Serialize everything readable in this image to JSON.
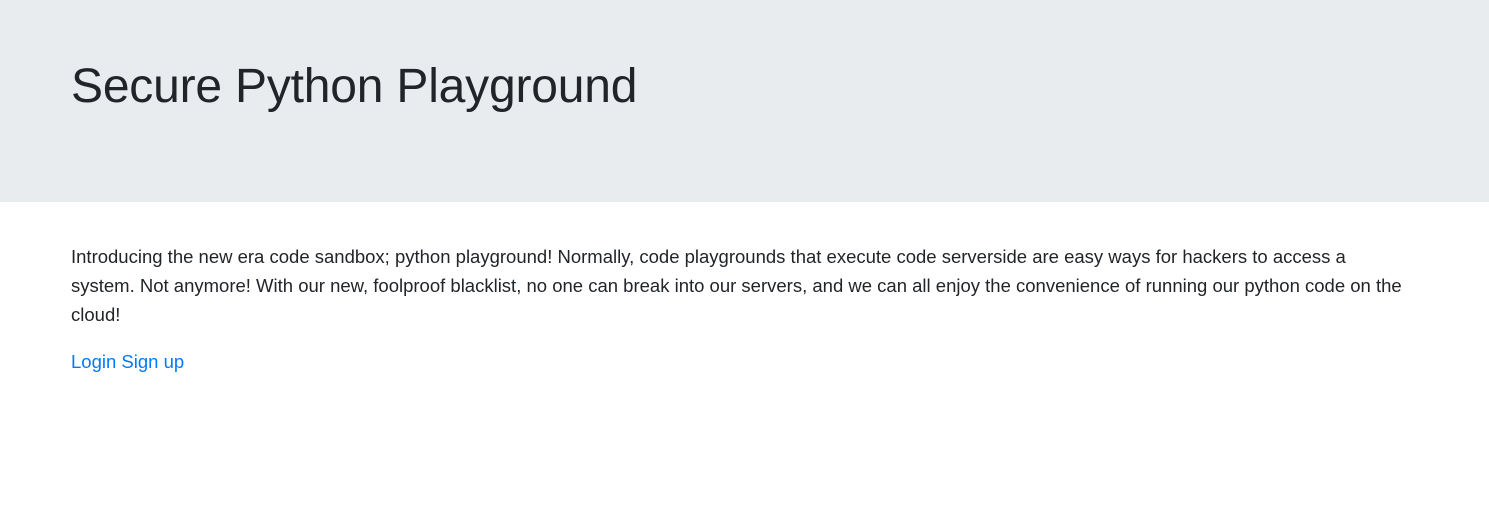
{
  "hero": {
    "title": "Secure Python Playground"
  },
  "main": {
    "intro": "Introducing the new era code sandbox; python playground! Normally, code playgrounds that execute code serverside are easy ways for hackers to access a system. Not anymore! With our new, foolproof blacklist, no one can break into our servers, and we can all enjoy the convenience of running our python code on the cloud!",
    "links": {
      "login": "Login",
      "signup": "Sign up"
    }
  },
  "colors": {
    "hero_background": "#e9ecef",
    "text": "#212529",
    "link": "#007bff"
  }
}
